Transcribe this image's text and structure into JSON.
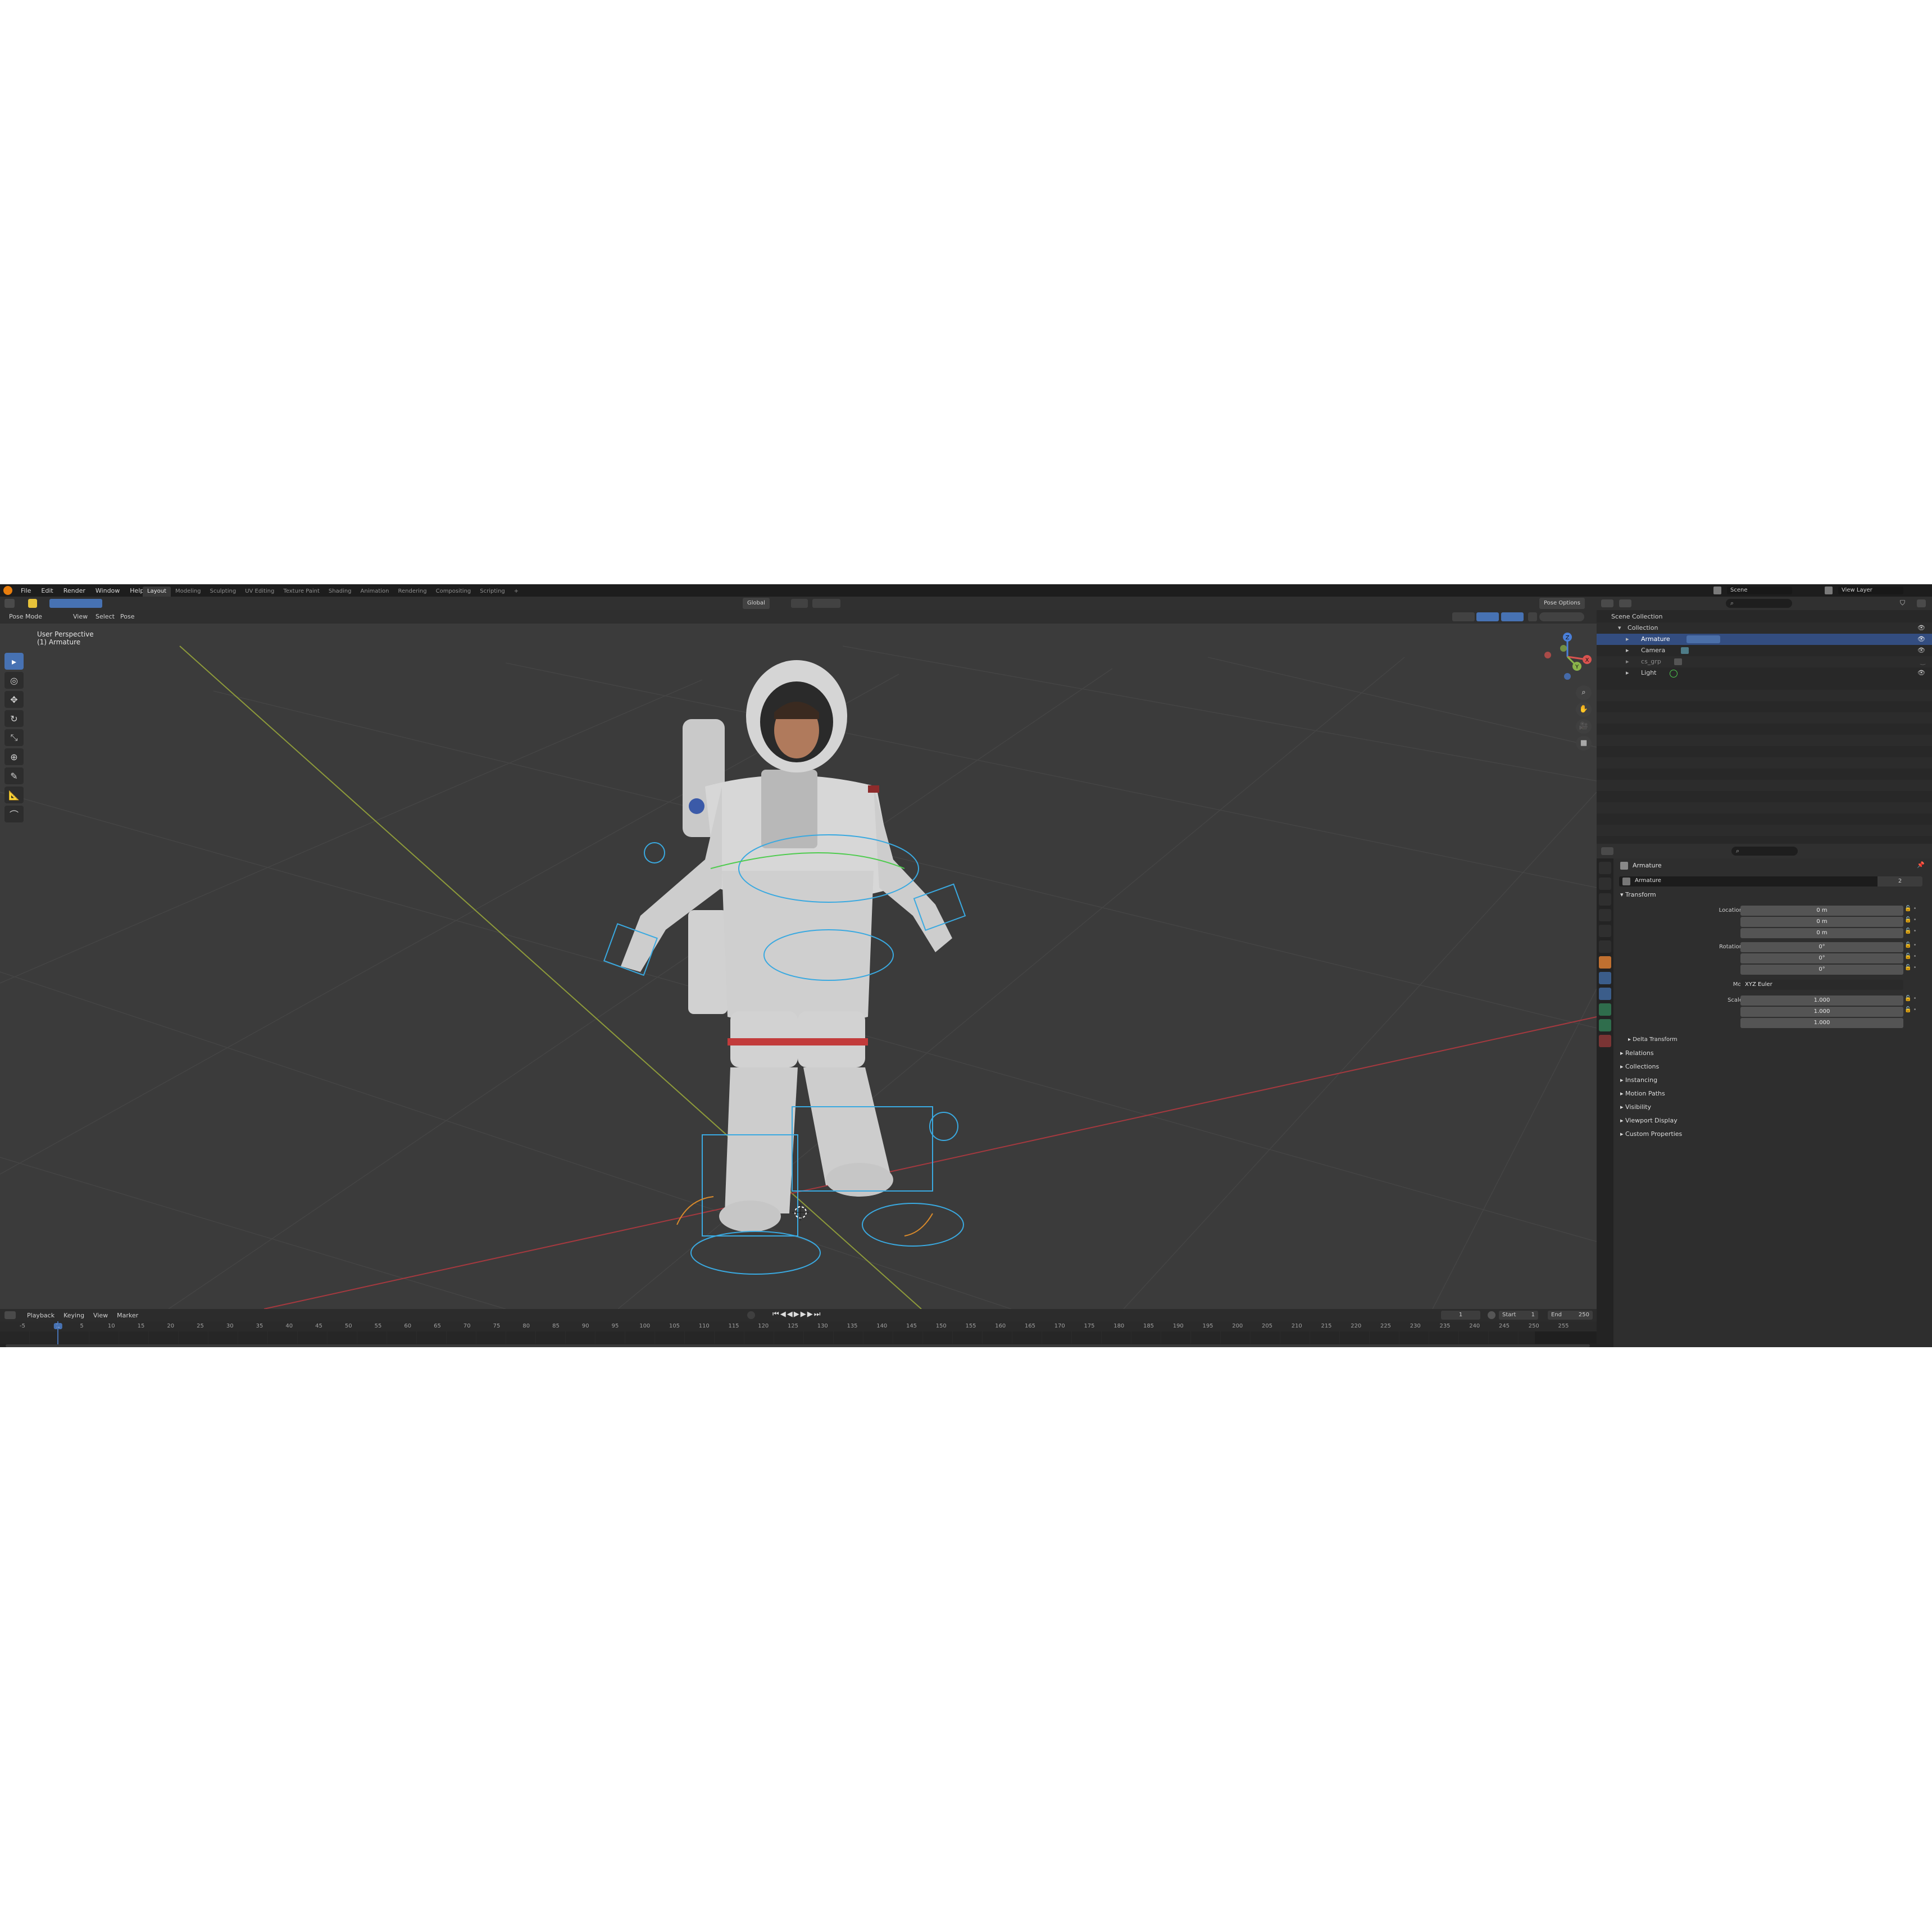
{
  "topbar": {
    "menus": [
      "File",
      "Edit",
      "Render",
      "Window",
      "Help"
    ],
    "workspaces": [
      "Layout",
      "Modeling",
      "Sculpting",
      "UV Editing",
      "Texture Paint",
      "Shading",
      "Animation",
      "Rendering",
      "Compositing",
      "Scripting"
    ],
    "active_workspace": "Layout",
    "add_tab": "+",
    "scene_label": "Scene",
    "view_layer_label": "View Layer"
  },
  "viewport": {
    "mode": "Pose Mode",
    "menus": [
      "View",
      "Select",
      "Pose"
    ],
    "transform_orientation": "Global",
    "options_label": "Pose Options",
    "overlay_line1": "User Perspective",
    "overlay_line2": "(1) Armature",
    "axis_labels": {
      "x": "X",
      "y": "Y",
      "z": "Z"
    }
  },
  "timeline": {
    "menus": [
      "Playback",
      "Keying",
      "View",
      "Marker"
    ],
    "current_frame": "1",
    "start_label": "Start",
    "start_value": "1",
    "end_label": "End",
    "end_value": "250",
    "ticks": [
      "-5",
      "1",
      "5",
      "10",
      "15",
      "20",
      "25",
      "30",
      "35",
      "40",
      "45",
      "50",
      "55",
      "60",
      "65",
      "70",
      "75",
      "80",
      "85",
      "90",
      "95",
      "100",
      "105",
      "110",
      "115",
      "120",
      "125",
      "130",
      "135",
      "140",
      "145",
      "150",
      "155",
      "160",
      "165",
      "170",
      "175",
      "180",
      "185",
      "190",
      "195",
      "200",
      "205",
      "210",
      "215",
      "220",
      "225",
      "230",
      "235",
      "240",
      "245",
      "250",
      "255"
    ]
  },
  "outliner": {
    "root": "Scene Collection",
    "collection": "Collection",
    "items": [
      "Armature",
      "Camera",
      "cs_grp",
      "Light"
    ],
    "selected": "Armature"
  },
  "properties": {
    "object_name": "Armature",
    "data_name": "Armature",
    "users": "2",
    "transform_title": "Transform",
    "location_label": "Location X",
    "location": [
      "0 m",
      "0 m",
      "0 m"
    ],
    "rotation_label": "Rotation X",
    "rotation": [
      "0°",
      "0°",
      "0°"
    ],
    "mode_label": "Mode",
    "mode_value": "XYZ Euler",
    "scale_label": "Scale X",
    "scale": [
      "1.000",
      "1.000",
      "1.000"
    ],
    "axis_y": "Y",
    "axis_z": "Z",
    "delta_transform": "Delta Transform",
    "sections": [
      "Relations",
      "Collections",
      "Instancing",
      "Motion Paths",
      "Visibility",
      "Viewport Display",
      "Custom Properties"
    ]
  },
  "colors": {
    "accent": "#4772b3",
    "x_axis": "#d9534f",
    "y_axis": "#8ab34a",
    "z_axis": "#4a7fd9",
    "bone_wire": "#3aa9e0"
  }
}
